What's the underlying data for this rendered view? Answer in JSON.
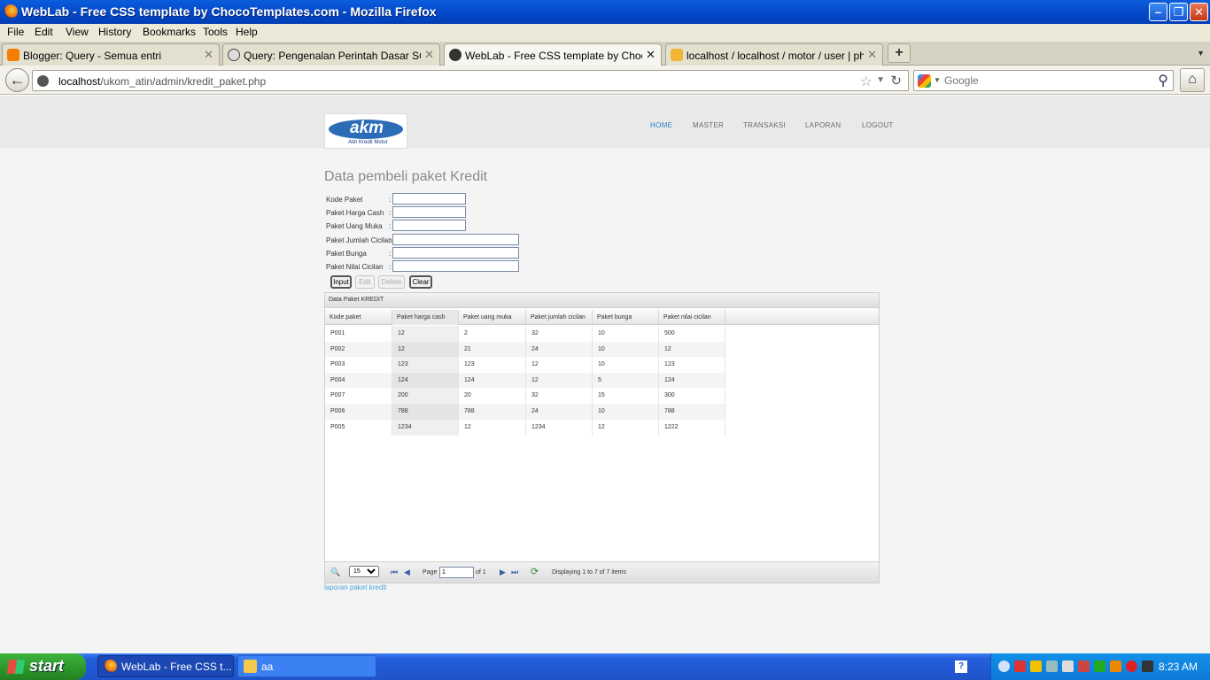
{
  "window": {
    "title": "WebLab - Free CSS template by ChocoTemplates.com - Mozilla Firefox"
  },
  "menu": [
    "File",
    "Edit",
    "View",
    "History",
    "Bookmarks",
    "Tools",
    "Help"
  ],
  "tabs": [
    {
      "label": "Blogger: Query - Semua entri",
      "icon": "blogger-icon",
      "active": false
    },
    {
      "label": "Query: Pengenalan Perintah Dasar SQL d...",
      "icon": "skull-icon",
      "active": false
    },
    {
      "label": "WebLab - Free CSS template by ChocoTe...",
      "icon": "site-icon",
      "active": true
    },
    {
      "label": "localhost / localhost / motor / user | php...",
      "icon": "phpmyadmin-icon",
      "active": false
    }
  ],
  "address": {
    "host": "localhost",
    "path": "/ukom_atin/admin/kredit_paket.php"
  },
  "search": {
    "placeholder": "Google"
  },
  "site": {
    "logo_text": "akm",
    "logo_sub": "Atin Kredit Motor",
    "nav": [
      "HOME",
      "MASTER",
      "TRANSAKSI",
      "LAPORAN",
      "LOGOUT"
    ]
  },
  "page": {
    "title": "Data pembeli paket Kredit",
    "fields": [
      {
        "label": "Kode Paket",
        "colon": ":"
      },
      {
        "label": "Paket Harga Cash",
        "colon": ":"
      },
      {
        "label": "Paket Uang Muka",
        "colon": ":"
      },
      {
        "label": "Paket Jumlah Cicilan",
        "colon": ":"
      },
      {
        "label": "Paket Bunga",
        "colon": ":"
      },
      {
        "label": "Paket Nilai Cicilan",
        "colon": ":"
      }
    ],
    "buttons": {
      "input": "Input",
      "edit": "Edit",
      "delete": "Delete",
      "clear": "Clear"
    },
    "report_link": "laporan paket kredit"
  },
  "grid": {
    "title": "Data Paket KREDIT",
    "columns": [
      "Kode paket",
      "Paket harga cash",
      "Paket uang muka",
      "Paket jumlah cicilan",
      "Paket bunga",
      "Paket nilai cicilan"
    ],
    "rows": [
      [
        "P001",
        "12",
        "2",
        "32",
        "10",
        "500"
      ],
      [
        "P002",
        "12",
        "21",
        "24",
        "10",
        "12"
      ],
      [
        "P003",
        "123",
        "123",
        "12",
        "10",
        "123"
      ],
      [
        "P004",
        "124",
        "124",
        "12",
        "5",
        "124"
      ],
      [
        "P007",
        "200",
        "20",
        "32",
        "15",
        "300"
      ],
      [
        "P006",
        "788",
        "788",
        "24",
        "10",
        "788"
      ],
      [
        "P005",
        "1234",
        "12",
        "1234",
        "12",
        "1222"
      ]
    ],
    "pager": {
      "page_size": "15",
      "page_label": "Page",
      "page_value": "1",
      "of_label": "of 1",
      "status": "Displaying 1 to 7 of 7 items"
    }
  },
  "taskbar": {
    "start": "start",
    "tasks": [
      {
        "label": "WebLab - Free CSS t...",
        "active": true
      },
      {
        "label": "aa",
        "active": false
      }
    ],
    "clock": "8:23 AM"
  }
}
